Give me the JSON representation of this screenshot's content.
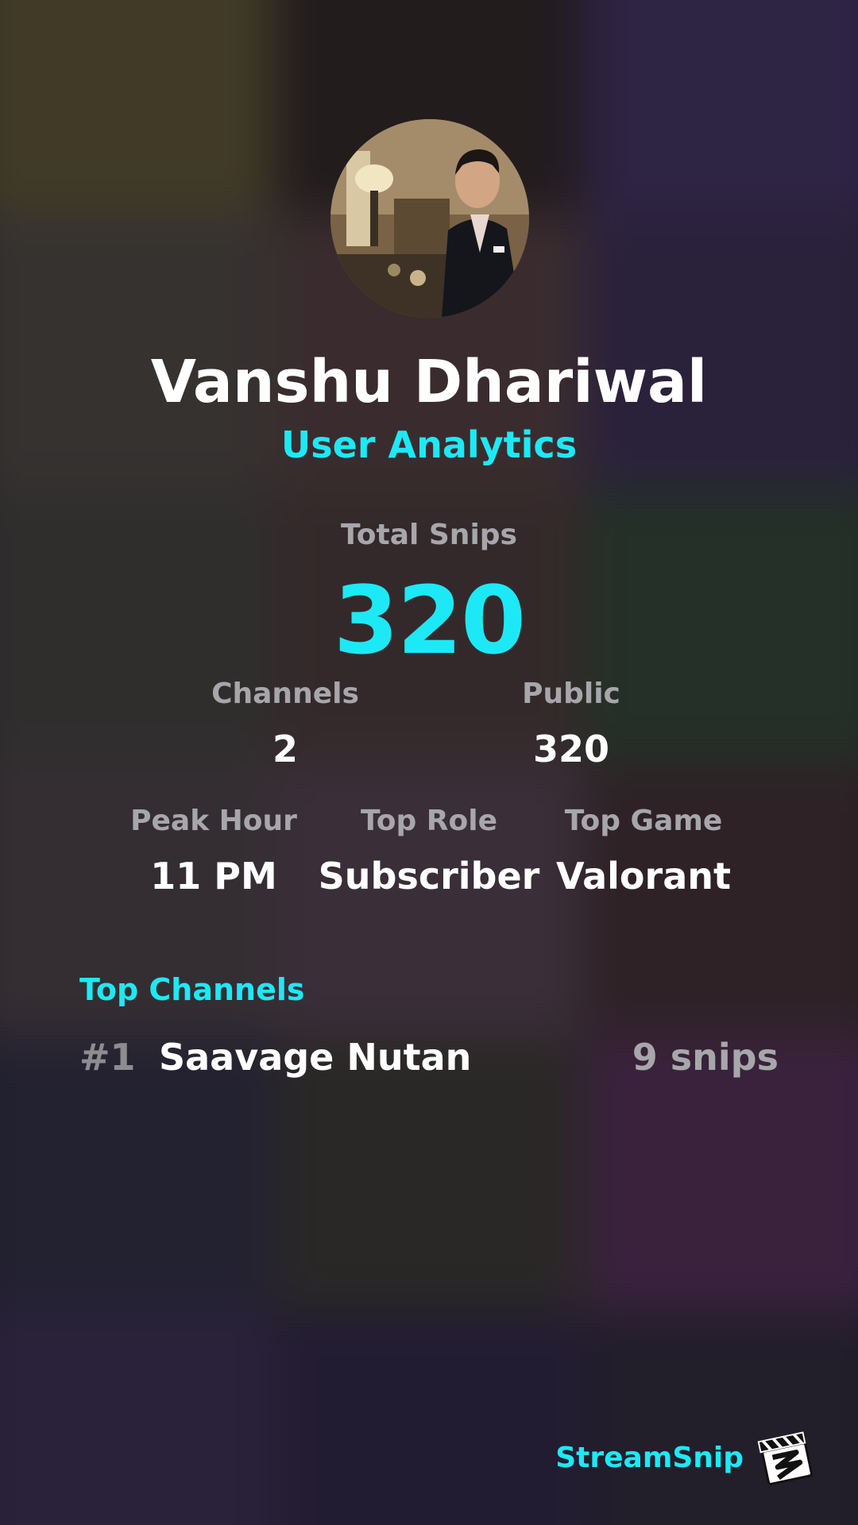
{
  "profile": {
    "name": "Vanshu Dhariwal",
    "subtitle": "User Analytics"
  },
  "totals": {
    "label": "Total Snips",
    "value": "320"
  },
  "stats": {
    "channels": {
      "label": "Channels",
      "value": "2"
    },
    "public": {
      "label": "Public",
      "value": "320"
    },
    "peak_hour": {
      "label": "Peak Hour",
      "value": "11 PM"
    },
    "top_role": {
      "label": "Top Role",
      "value": "Subscriber"
    },
    "top_game": {
      "label": "Top Game",
      "value": "Valorant"
    }
  },
  "top_channels": {
    "heading": "Top Channels",
    "items": [
      {
        "rank": "#1",
        "name": "Saavage Nutan",
        "count": "9 snips"
      }
    ]
  },
  "brand": {
    "name": "StreamSnip",
    "icon": "clapperboard-icon"
  },
  "colors": {
    "accent": "#1de9f6",
    "label_gray": "#a7a7ab",
    "text": "#ffffff"
  }
}
